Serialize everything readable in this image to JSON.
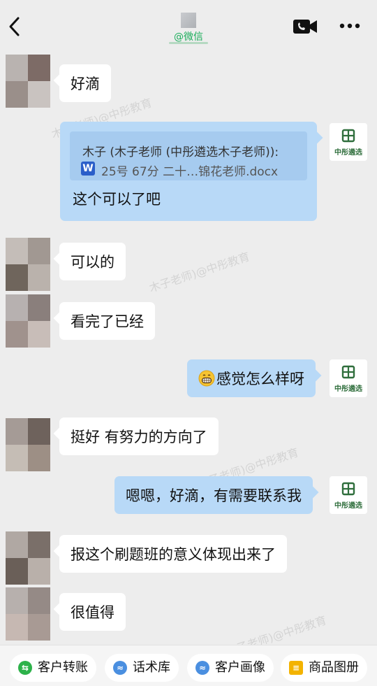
{
  "header": {
    "source_label": "@微信",
    "back_icon": "chevron-left-icon",
    "video_icon": "video-call-icon",
    "more_icon": "more-dots-icon"
  },
  "contact_logo_text": "中彤遴选",
  "messages": {
    "m1": "好滴",
    "quote": {
      "author": "木子 (木子老师 (中彤遴选木子老师)):",
      "file_icon_letter": "W",
      "file_name": "25号 67分 二十…锦花老师.docx",
      "reply": "这个可以了吧"
    },
    "m2": "可以的",
    "m3": "看完了已经",
    "m4": "感觉怎么样呀",
    "m5": "挺好 有努力的方向了",
    "m6": "嗯嗯，好滴，有需要联系我",
    "m7": "报这个刷题班的意义体现出来了",
    "m8": "很值得"
  },
  "watermark": "木子老师)@中彤教育",
  "toolbar": {
    "items": [
      {
        "label": "客户转账",
        "icon": "transfer-icon",
        "color": "#2db24a"
      },
      {
        "label": "话术库",
        "icon": "script-library-icon",
        "color": "#4a8fe0"
      },
      {
        "label": "客户画像",
        "icon": "customer-profile-icon",
        "color": "#4a8fe0"
      },
      {
        "label": "商品图册",
        "icon": "product-album-icon",
        "color": "#f3b300"
      }
    ]
  },
  "colors": {
    "background": "#ededed",
    "incoming_bubble": "#ffffff",
    "outgoing_bubble": "#b8d9f7",
    "wechat_green": "#1aad5a"
  }
}
